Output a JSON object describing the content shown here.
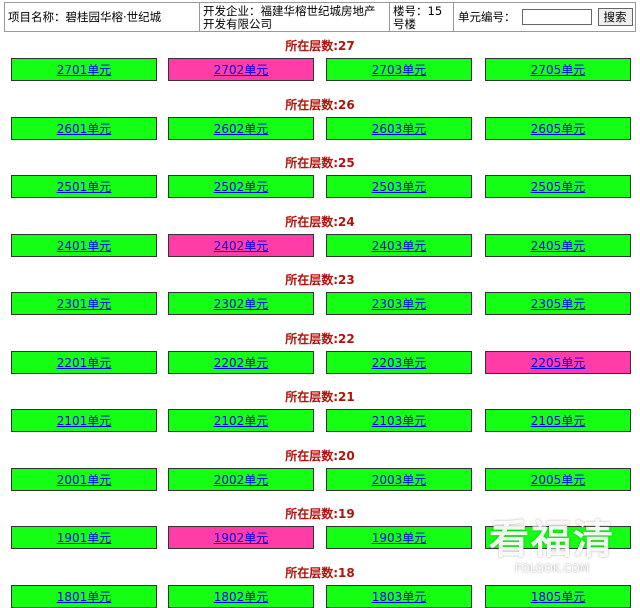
{
  "header": {
    "project": "项目名称：碧桂园华榕·世纪城",
    "developer": "开发企业：福建华榕世纪城房地产开发有限公司",
    "building": "楼号：15号楼",
    "unit_label": "单元编号：",
    "search_value": "",
    "search_button": "搜索"
  },
  "floors": [
    {
      "title": "所在层数:27",
      "units": [
        {
          "label": "2701单元",
          "status": "green"
        },
        {
          "label": "2702单元",
          "status": "pink"
        },
        {
          "label": "2703单元",
          "status": "green"
        },
        {
          "label": "2705单元",
          "status": "green"
        }
      ]
    },
    {
      "title": "所在层数:26",
      "units": [
        {
          "label": "2601单元",
          "status": "green"
        },
        {
          "label": "2602单元",
          "status": "green"
        },
        {
          "label": "2603单元",
          "status": "green"
        },
        {
          "label": "2605单元",
          "status": "green"
        }
      ]
    },
    {
      "title": "所在层数:25",
      "units": [
        {
          "label": "2501单元",
          "status": "green"
        },
        {
          "label": "2502单元",
          "status": "green"
        },
        {
          "label": "2503单元",
          "status": "green"
        },
        {
          "label": "2505单元",
          "status": "green"
        }
      ]
    },
    {
      "title": "所在层数:24",
      "units": [
        {
          "label": "2401单元",
          "status": "green"
        },
        {
          "label": "2402单元",
          "status": "pink"
        },
        {
          "label": "2403单元",
          "status": "green"
        },
        {
          "label": "2405单元",
          "status": "green"
        }
      ]
    },
    {
      "title": "所在层数:23",
      "units": [
        {
          "label": "2301单元",
          "status": "green"
        },
        {
          "label": "2302单元",
          "status": "green"
        },
        {
          "label": "2303单元",
          "status": "green"
        },
        {
          "label": "2305单元",
          "status": "green"
        }
      ]
    },
    {
      "title": "所在层数:22",
      "units": [
        {
          "label": "2201单元",
          "status": "green"
        },
        {
          "label": "2202单元",
          "status": "green"
        },
        {
          "label": "2203单元",
          "status": "green"
        },
        {
          "label": "2205单元",
          "status": "pink"
        }
      ]
    },
    {
      "title": "所在层数:21",
      "units": [
        {
          "label": "2101单元",
          "status": "green"
        },
        {
          "label": "2102单元",
          "status": "green"
        },
        {
          "label": "2103单元",
          "status": "green"
        },
        {
          "label": "2105单元",
          "status": "green"
        }
      ]
    },
    {
      "title": "所在层数:20",
      "units": [
        {
          "label": "2001单元",
          "status": "green"
        },
        {
          "label": "2002单元",
          "status": "green"
        },
        {
          "label": "2003单元",
          "status": "green"
        },
        {
          "label": "2005单元",
          "status": "green"
        }
      ]
    },
    {
      "title": "所在层数:19",
      "units": [
        {
          "label": "1901单元",
          "status": "green"
        },
        {
          "label": "1902单元",
          "status": "pink"
        },
        {
          "label": "1903单元",
          "status": "green"
        },
        {
          "label": "",
          "status": "green"
        }
      ]
    },
    {
      "title": "所在层数:18",
      "units": [
        {
          "label": "1801单元",
          "status": "green"
        },
        {
          "label": "1802单元",
          "status": "green"
        },
        {
          "label": "1803单元",
          "status": "green"
        },
        {
          "label": "1805单元",
          "status": "green"
        }
      ]
    }
  ],
  "watermark": {
    "main": "看福清",
    "sub": "FOLOOK.COM"
  }
}
